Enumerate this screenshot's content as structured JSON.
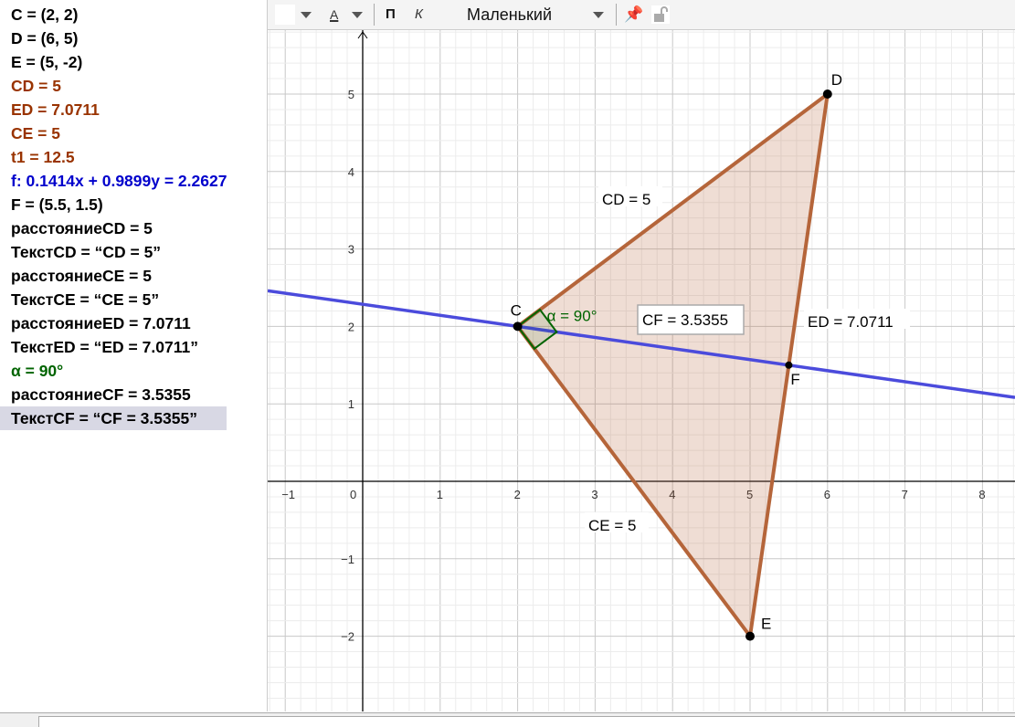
{
  "algebra": [
    {
      "text": "C = (2, 2)",
      "color": "#000000"
    },
    {
      "text": "D = (6, 5)",
      "color": "#000000"
    },
    {
      "text": "E = (5, -2)",
      "color": "#000000"
    },
    {
      "text": "CD = 5",
      "color": "#993300"
    },
    {
      "text": "ED = 7.0711",
      "color": "#993300"
    },
    {
      "text": "CE = 5",
      "color": "#993300"
    },
    {
      "text": "t1 = 12.5",
      "color": "#993300"
    },
    {
      "text": "f: 0.1414x + 0.9899y = 2.2627",
      "color": "#0000cc"
    },
    {
      "text": "F = (5.5, 1.5)",
      "color": "#000000"
    },
    {
      "text": "расстояниеCD = 5",
      "color": "#000000"
    },
    {
      "text": "ТекстCD = “CD = 5”",
      "color": "#000000"
    },
    {
      "text": "расстояниеCE = 5",
      "color": "#000000"
    },
    {
      "text": "ТекстCE = “CE = 5”",
      "color": "#000000"
    },
    {
      "text": "расстояниеED = 7.0711",
      "color": "#000000"
    },
    {
      "text": "ТекстED = “ED = 7.0711”",
      "color": "#000000"
    },
    {
      "text": "α = 90°",
      "color": "#006400"
    },
    {
      "text": "расстояниеCF = 3.5355",
      "color": "#000000"
    },
    {
      "text": "ТекстCF = “CF = 3.5355”",
      "color": "#000000",
      "selected": true
    }
  ],
  "toolbar": {
    "text_color_label": "A",
    "bold_label": "П",
    "italic_label": "К",
    "font_size": "Маленький"
  },
  "graph": {
    "points": [
      {
        "name": "C",
        "x": 2,
        "y": 2
      },
      {
        "name": "D",
        "x": 6,
        "y": 5
      },
      {
        "name": "E",
        "x": 5,
        "y": -2
      },
      {
        "name": "F",
        "x": 5.5,
        "y": 1.5
      }
    ],
    "line_f": {
      "a": 0.1414,
      "b": 0.9899,
      "c": 2.2627,
      "color": "#4b4bdc"
    },
    "polygon_color": "#b5653a",
    "angle_label": "α = 90°",
    "labels": {
      "CD": "CD = 5",
      "CE": "CE = 5",
      "ED": "ED = 7.0711",
      "CF": "CF = 3.5355"
    },
    "x_ticks": [
      -1,
      0,
      1,
      2,
      3,
      4,
      5,
      6,
      7,
      8
    ],
    "y_ticks": [
      -2,
      -1,
      1,
      2,
      3,
      4,
      5
    ]
  }
}
